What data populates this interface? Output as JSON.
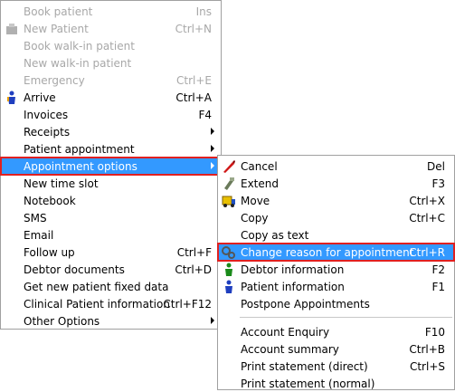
{
  "main_menu": {
    "book_patient": {
      "label": "Book patient",
      "shortcut": "Ins"
    },
    "new_patient": {
      "label": "New Patient",
      "shortcut": "Ctrl+N"
    },
    "book_walkin": {
      "label": "Book walk-in patient"
    },
    "new_walkin": {
      "label": "New walk-in patient"
    },
    "emergency": {
      "label": "Emergency",
      "shortcut": "Ctrl+E"
    },
    "arrive": {
      "label": "Arrive",
      "shortcut": "Ctrl+A"
    },
    "invoices": {
      "label": "Invoices",
      "shortcut": "F4"
    },
    "receipts": {
      "label": "Receipts"
    },
    "patient_appointment": {
      "label": "Patient appointment"
    },
    "appointment_options": {
      "label": "Appointment options"
    },
    "new_time_slot": {
      "label": "New time slot"
    },
    "notebook": {
      "label": "Notebook"
    },
    "sms": {
      "label": "SMS"
    },
    "email": {
      "label": "Email"
    },
    "follow_up": {
      "label": "Follow up",
      "shortcut": "Ctrl+F"
    },
    "debtor_documents": {
      "label": "Debtor documents",
      "shortcut": "Ctrl+D"
    },
    "fixed_data": {
      "label": "Get new patient fixed data"
    },
    "clinical_info": {
      "label": "Clinical Patient information",
      "shortcut": "Ctrl+F12"
    },
    "other_options": {
      "label": "Other Options"
    }
  },
  "sub_menu": {
    "cancel": {
      "label": "Cancel",
      "shortcut": "Del"
    },
    "extend": {
      "label": "Extend",
      "shortcut": "F3"
    },
    "move": {
      "label": "Move",
      "shortcut": "Ctrl+X"
    },
    "copy": {
      "label": "Copy",
      "shortcut": "Ctrl+C"
    },
    "copy_as_text": {
      "label": "Copy as text"
    },
    "change_reason": {
      "label": "Change reason for appointment",
      "shortcut": "Ctrl+R"
    },
    "debtor_information": {
      "label": "Debtor information",
      "shortcut": "F2"
    },
    "patient_information": {
      "label": "Patient information",
      "shortcut": "F1"
    },
    "postpone": {
      "label": "Postpone Appointments"
    },
    "account_enquiry": {
      "label": "Account Enquiry",
      "shortcut": "F10"
    },
    "account_summary": {
      "label": "Account summary",
      "shortcut": "Ctrl+B"
    },
    "print_direct": {
      "label": "Print statement (direct)",
      "shortcut": "Ctrl+S"
    },
    "print_normal": {
      "label": "Print statement (normal)"
    }
  },
  "colors": {
    "highlight": "#3399ff",
    "highlight_border": "#e02020",
    "disabled_text": "#a8a8a8"
  }
}
